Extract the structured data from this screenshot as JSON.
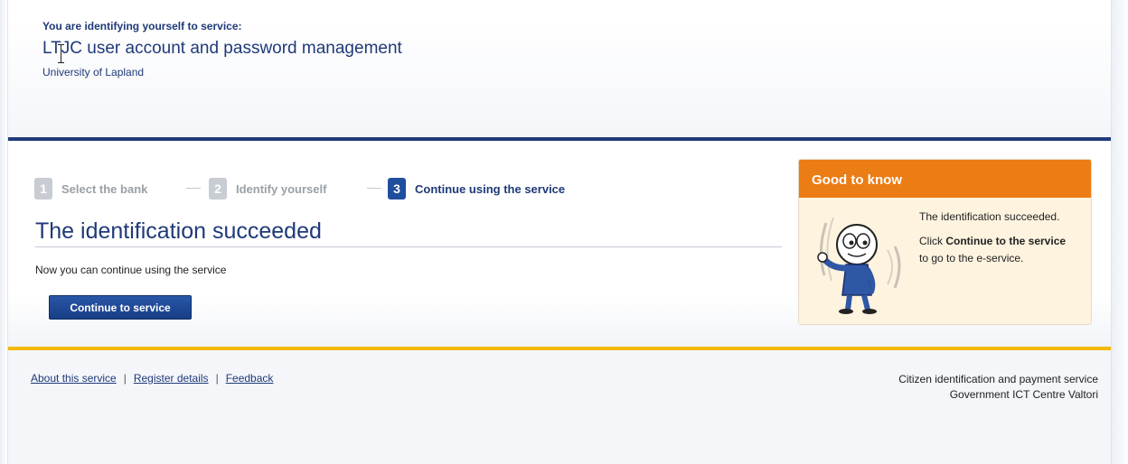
{
  "header": {
    "intro": "You are identifying yourself to service:",
    "service_name": "LTJC user account and password management",
    "organization": "University of Lapland"
  },
  "steps": [
    {
      "number": "1",
      "label": "Select the bank",
      "state": "inactive"
    },
    {
      "number": "2",
      "label": "Identify yourself",
      "state": "inactive"
    },
    {
      "number": "3",
      "label": "Continue using the service",
      "state": "active"
    }
  ],
  "main": {
    "title": "The identification succeeded",
    "text": "Now you can continue using the service",
    "continue_label": "Continue to service"
  },
  "info_box": {
    "title": "Good to know",
    "line1": "The identification succeeded.",
    "line2_prefix": "Click ",
    "line2_bold": "Continue to the service",
    "line2_suffix": " to go to the e-service.",
    "illustration_icon": "waving-cartoon-figure-icon"
  },
  "footer": {
    "links": [
      "About this service",
      "Register details",
      "Feedback"
    ],
    "separator": "|",
    "provider_line1": "Citizen identification and payment service",
    "provider_line2": "Government ICT Centre Valtori"
  },
  "colors": {
    "navy": "#1f3a78",
    "accent_orange": "#ec7c14",
    "gold": "#f4b800",
    "info_bg": "#fdf3df"
  }
}
